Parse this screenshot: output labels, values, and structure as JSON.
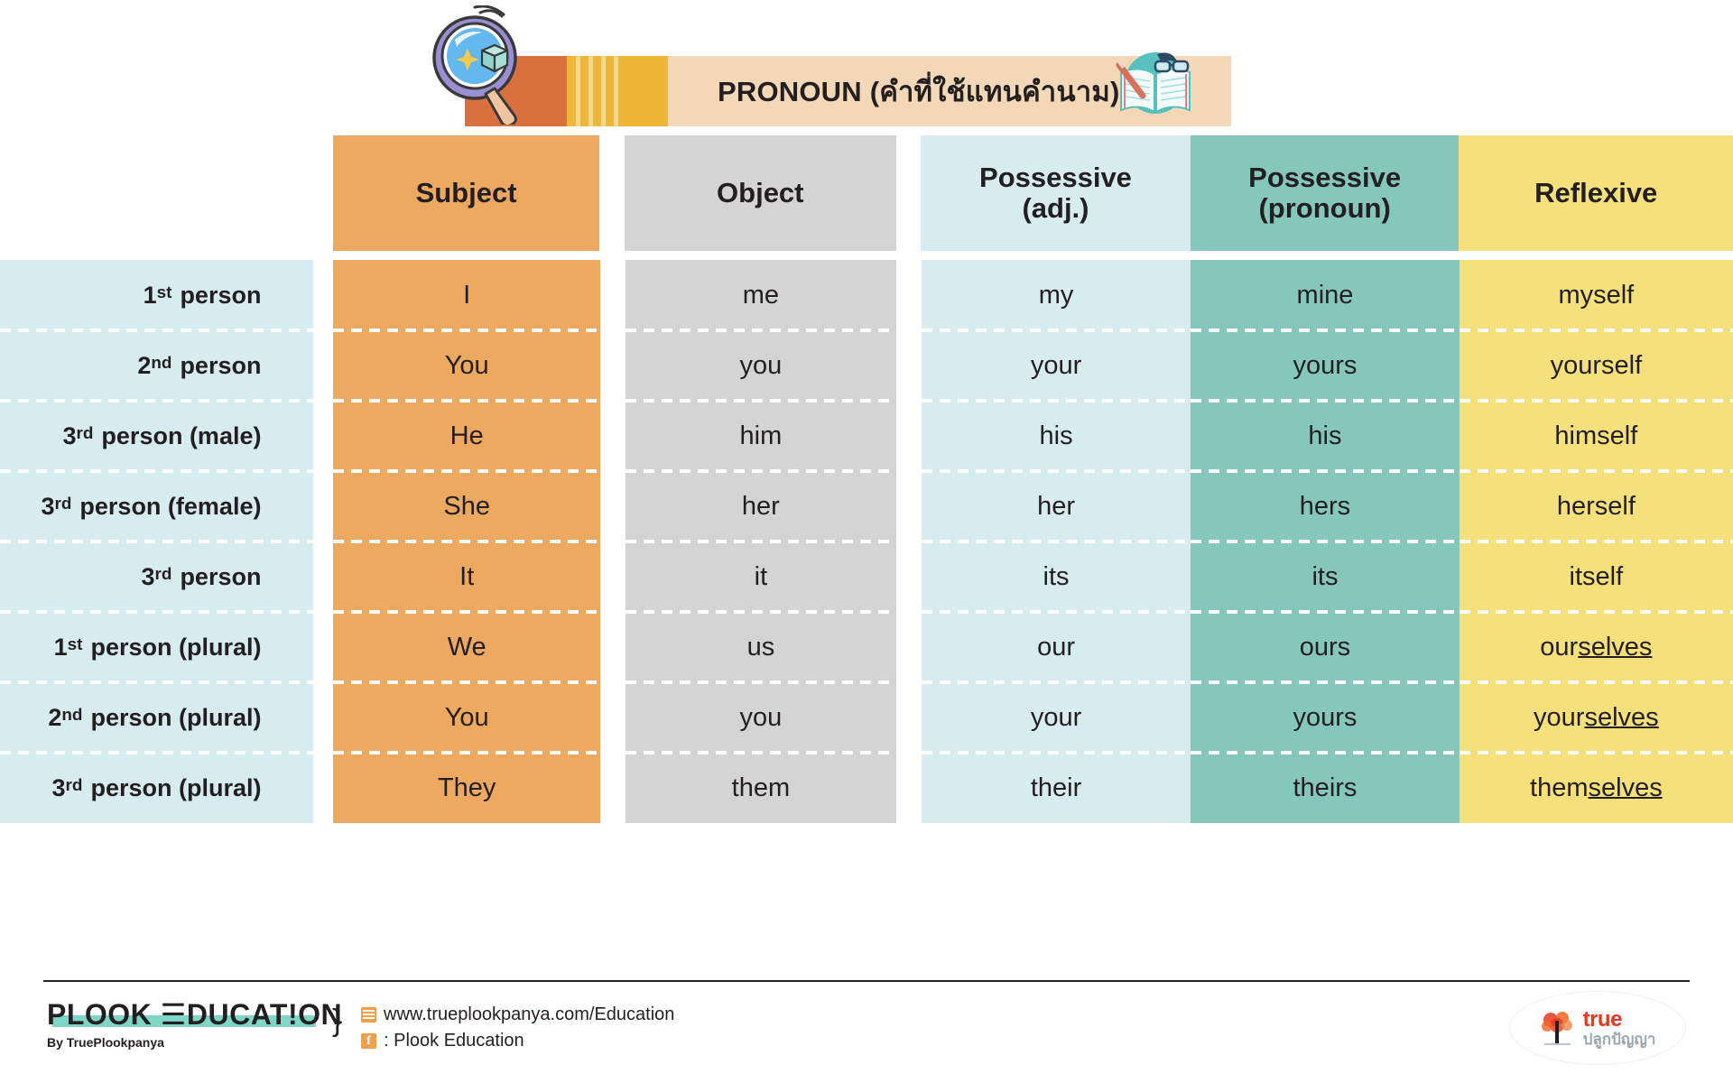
{
  "header": {
    "title_en": "PRONOUN",
    "title_th": "(คำที่ใช้แทนคำนาม)",
    "magnifier_icon": "magnifying-glass-icon",
    "book_icon": "open-book-with-glasses-icon"
  },
  "table": {
    "corner_label": "",
    "columns": [
      {
        "line1": "Subject",
        "line2": ""
      },
      {
        "line1": "Object",
        "line2": ""
      },
      {
        "line1": "Possessive",
        "line2": "(adj.)"
      },
      {
        "line1": "Possessive",
        "line2": "(pronoun)"
      },
      {
        "line1": "Reflexive",
        "line2": ""
      }
    ],
    "rows": [
      {
        "label_num": "1",
        "label_sup": "st",
        "label_rest": "person",
        "label_full": "1st person",
        "subject": "I",
        "object": "me",
        "poss_adj": "my",
        "poss_pron": "mine",
        "reflexive_plain": "myself",
        "reflexive_pre": "myself",
        "reflexive_underline": ""
      },
      {
        "label_num": "2",
        "label_sup": "nd",
        "label_rest": "person",
        "label_full": "2nd person",
        "subject": "You",
        "object": "you",
        "poss_adj": "your",
        "poss_pron": "yours",
        "reflexive_plain": "yourself",
        "reflexive_pre": "yourself",
        "reflexive_underline": ""
      },
      {
        "label_num": "3",
        "label_sup": "rd",
        "label_rest": "person (male)",
        "label_full": "3rd person (male)",
        "subject": "He",
        "object": "him",
        "poss_adj": "his",
        "poss_pron": "his",
        "reflexive_plain": "himself",
        "reflexive_pre": "himself",
        "reflexive_underline": ""
      },
      {
        "label_num": "3",
        "label_sup": "rd",
        "label_rest": "person (female)",
        "label_full": "3rd person (female)",
        "subject": "She",
        "object": "her",
        "poss_adj": "her",
        "poss_pron": "hers",
        "reflexive_plain": "herself",
        "reflexive_pre": "herself",
        "reflexive_underline": ""
      },
      {
        "label_num": "3",
        "label_sup": "rd",
        "label_rest": "person",
        "label_full": "3rd person",
        "subject": "It",
        "object": "it",
        "poss_adj": "its",
        "poss_pron": "its",
        "reflexive_plain": "itself",
        "reflexive_pre": "itself",
        "reflexive_underline": ""
      },
      {
        "label_num": "1",
        "label_sup": "st",
        "label_rest": "person (plural)",
        "label_full": "1st person (plural)",
        "subject": "We",
        "object": "us",
        "poss_adj": "our",
        "poss_pron": "ours",
        "reflexive_plain": "ourselves",
        "reflexive_pre": "our",
        "reflexive_underline": "selves"
      },
      {
        "label_num": "2",
        "label_sup": "nd",
        "label_rest": "person (plural)",
        "label_full": "2nd person (plural)",
        "subject": "You",
        "object": "you",
        "poss_adj": "your",
        "poss_pron": "yours",
        "reflexive_plain": "yourselves",
        "reflexive_pre": "your",
        "reflexive_underline": "selves"
      },
      {
        "label_num": "3",
        "label_sup": "rd",
        "label_rest": "person (plural)",
        "label_full": "3rd person (plural)",
        "subject": "They",
        "object": "them",
        "poss_adj": "their",
        "poss_pron": "theirs",
        "reflexive_plain": "themselves",
        "reflexive_pre": "them",
        "reflexive_underline": "selves"
      }
    ]
  },
  "footer": {
    "logo_text": "PLOOK ☰DUCAT!ON",
    "logo_sub": "By TruePlookpanya",
    "brace": "}",
    "website": "www.trueplookpanya.com/Education",
    "facebook": ": Plook Education",
    "web_icon": "website-icon",
    "fb_icon": "facebook-icon",
    "true_logo_main": "true",
    "true_logo_sub": "ปลูกปัญญา",
    "true_logo_icon": "tree-icon"
  },
  "colors": {
    "subject": "#eda95f",
    "object": "#d4d4d4",
    "possessive_adj": "#d7ecee",
    "possessive_pronoun": "#86c7bb",
    "reflexive": "#f6e07c",
    "label_column": "#d7ecee",
    "banner_orange": "#d9713f",
    "banner_yellow": "#eeb737",
    "banner_tan": "#f3d8b8"
  }
}
